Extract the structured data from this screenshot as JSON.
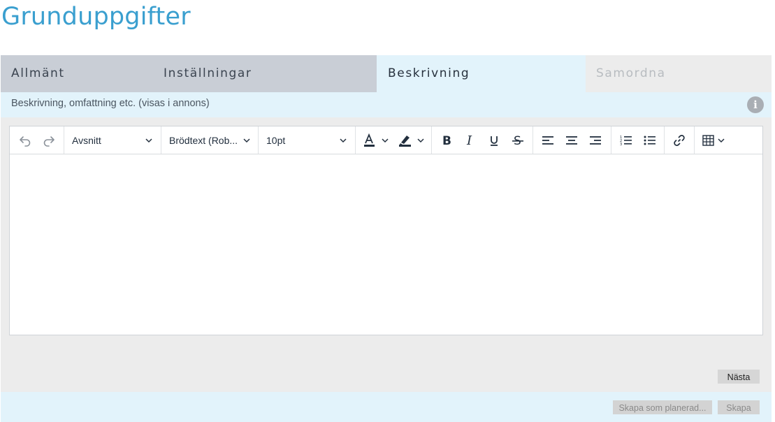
{
  "page": {
    "title": "Grunduppgifter"
  },
  "tabs": [
    {
      "label": "Allmänt",
      "state": "inactive"
    },
    {
      "label": "Inställningar",
      "state": "inactive"
    },
    {
      "label": "Beskrivning",
      "state": "active"
    },
    {
      "label": "Samordna",
      "state": "disabled"
    }
  ],
  "description": {
    "label": "Beskrivning, omfattning etc. (visas i annons)",
    "info_icon": "info-icon"
  },
  "editor": {
    "block_format": "Avsnitt",
    "font_family": "Brödtext (Rob...",
    "font_size": "10pt",
    "content": ""
  },
  "buttons": {
    "next": "Nästa",
    "create_planned": "Skapa som planerad...",
    "create": "Skapa"
  },
  "colors": {
    "title": "#3a9fcf",
    "active_tab_bg": "#e2f3fb",
    "inactive_tab_bg": "#c9ced6",
    "panel_bg": "#ececec"
  }
}
